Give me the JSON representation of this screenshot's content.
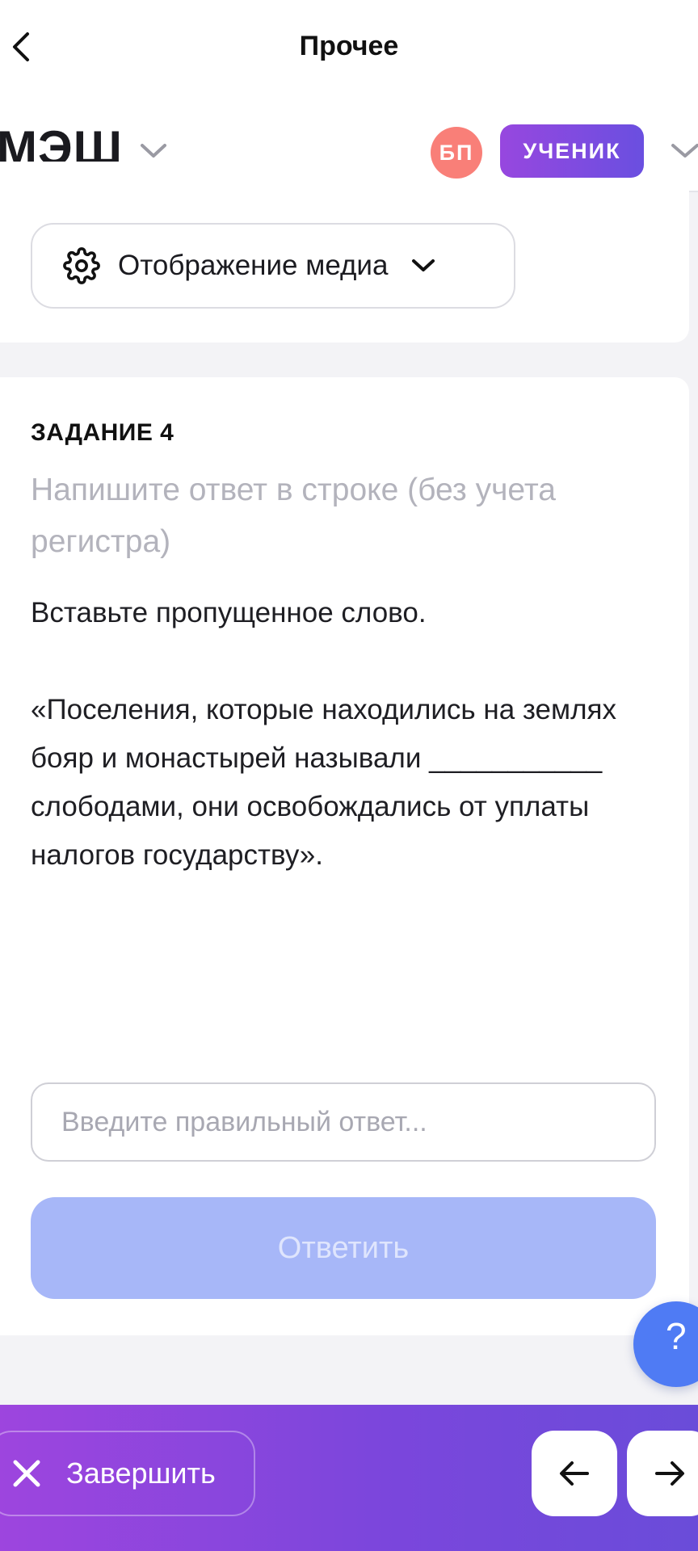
{
  "nav": {
    "title": "Прочее"
  },
  "header": {
    "logo": "МЭШ",
    "avatar_initials": "БП",
    "role": "УЧЕНИК"
  },
  "card_top": {
    "media_button": "Отображение медиа"
  },
  "task": {
    "heading": "ЗАДАНИЕ 4",
    "hint": "Напишите ответ в строке (без учета регистра)",
    "instruction": "Вставьте пропущенное слово.",
    "quote": "«Поселения, которые находились на землях бояр и монастырей называли ___________ слободами, они освобождались от уплаты налогов государству».",
    "input_placeholder": "Введите правильный ответ...",
    "submit_label": "Ответить"
  },
  "help": {
    "label": "?"
  },
  "bottom_bar": {
    "finish_label": "Завершить"
  },
  "colors": {
    "brand_purple": "#9747df",
    "brand_violet": "#6a4fe0",
    "avatar_bg": "#f97f78",
    "submit_disabled": "#a7b7f8",
    "help_blue": "#4f7bf4"
  },
  "icons": {
    "back": "chevron-left-icon",
    "header_menu": "chevron-down-icon",
    "media_settings": "gear-icon",
    "media_toggle": "chevron-down-icon",
    "finish": "close-icon",
    "prev": "arrow-left-icon",
    "next": "arrow-right-icon"
  }
}
